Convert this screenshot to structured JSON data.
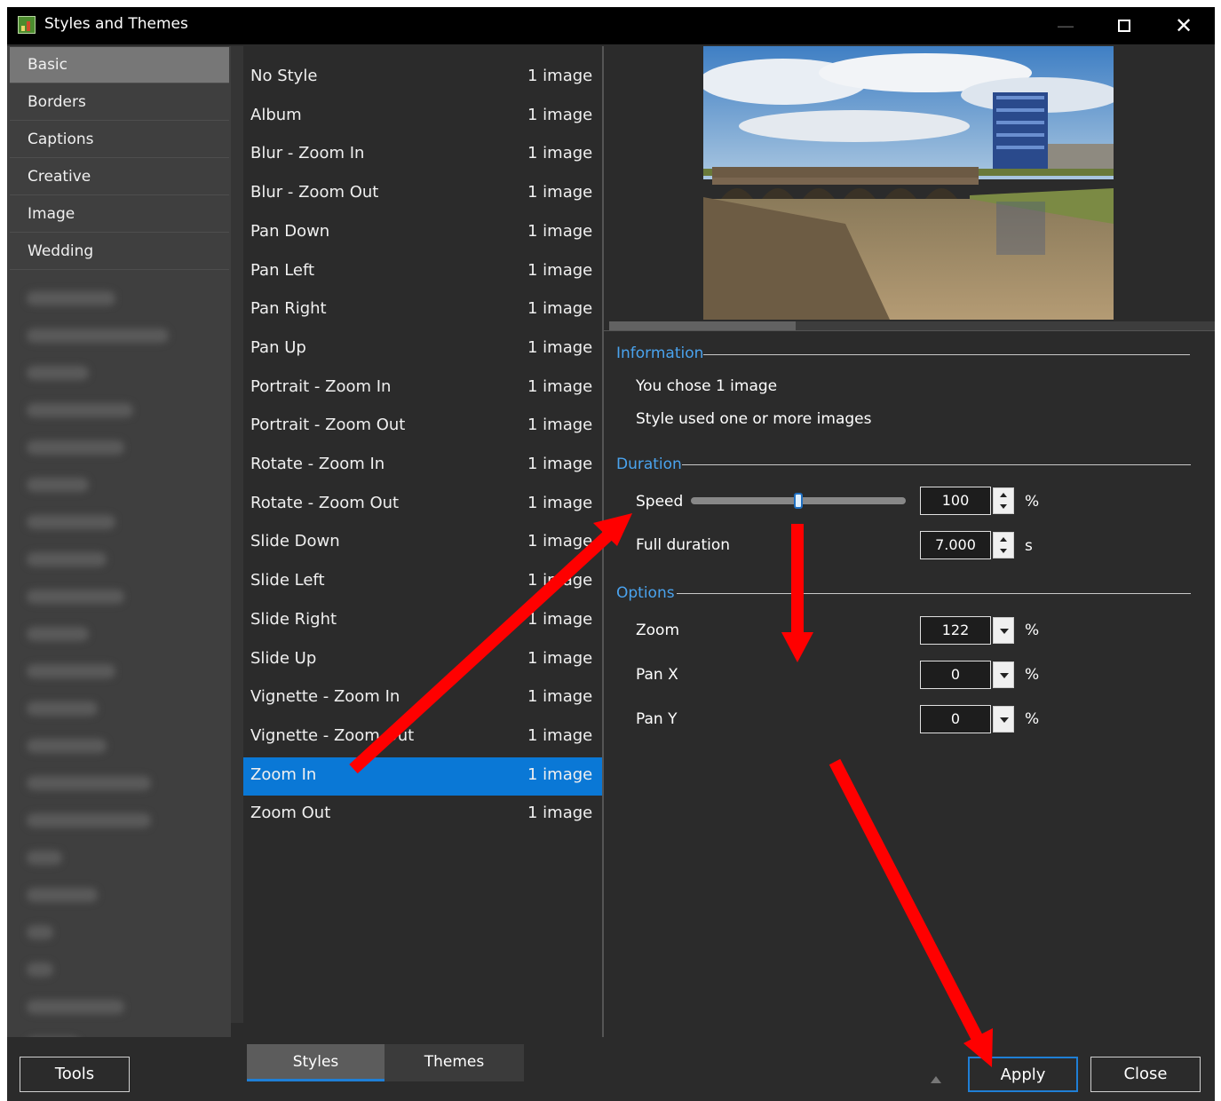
{
  "window": {
    "title": "Styles and Themes",
    "minimize_glyph": "—",
    "close_glyph": "✕"
  },
  "categories": [
    {
      "label": "Basic",
      "selected": true
    },
    {
      "label": "Borders",
      "selected": false
    },
    {
      "label": "Captions",
      "selected": false
    },
    {
      "label": "Creative",
      "selected": false
    },
    {
      "label": "Image",
      "selected": false
    },
    {
      "label": "Wedding",
      "selected": false
    }
  ],
  "styles": [
    {
      "name": "No Style",
      "count": "1 image"
    },
    {
      "name": "Album",
      "count": "1 image"
    },
    {
      "name": "Blur - Zoom In",
      "count": "1 image"
    },
    {
      "name": "Blur - Zoom Out",
      "count": "1 image"
    },
    {
      "name": "Pan Down",
      "count": "1 image"
    },
    {
      "name": "Pan Left",
      "count": "1 image"
    },
    {
      "name": "Pan Right",
      "count": "1 image"
    },
    {
      "name": "Pan Up",
      "count": "1 image"
    },
    {
      "name": "Portrait - Zoom In",
      "count": "1 image"
    },
    {
      "name": "Portrait - Zoom Out",
      "count": "1 image"
    },
    {
      "name": "Rotate - Zoom In",
      "count": "1 image"
    },
    {
      "name": "Rotate - Zoom Out",
      "count": "1 image"
    },
    {
      "name": "Slide Down",
      "count": "1 image"
    },
    {
      "name": "Slide Left",
      "count": "1 image"
    },
    {
      "name": "Slide Right",
      "count": "1 image"
    },
    {
      "name": "Slide Up",
      "count": "1 image"
    },
    {
      "name": "Vignette - Zoom In",
      "count": "1 image"
    },
    {
      "name": "Vignette - Zoom Out",
      "count": "1 image"
    },
    {
      "name": "Zoom In",
      "count": "1 image",
      "selected": true
    },
    {
      "name": "Zoom Out",
      "count": "1 image"
    }
  ],
  "information": {
    "title": "Information",
    "line1": "You chose 1 image",
    "line2": "Style used one or more images"
  },
  "duration": {
    "title": "Duration",
    "speed_label": "Speed",
    "speed_value": "100",
    "speed_unit": "%",
    "speed_slider_fraction": 0.5,
    "full_duration_label": "Full duration",
    "full_duration_value": "7.000",
    "full_duration_unit": "s"
  },
  "options": {
    "title": "Options",
    "zoom_label": "Zoom",
    "zoom_value": "122",
    "zoom_unit": "%",
    "panx_label": "Pan X",
    "panx_value": "0",
    "panx_unit": "%",
    "pany_label": "Pan Y",
    "pany_value": "0",
    "pany_unit": "%"
  },
  "bottom": {
    "tools_label": "Tools",
    "tab_styles": "Styles",
    "tab_themes": "Themes",
    "apply_label": "Apply",
    "close_label": "Close"
  },
  "colors": {
    "accent": "#0a78d6",
    "annotation_arrow": "#ff0000"
  }
}
